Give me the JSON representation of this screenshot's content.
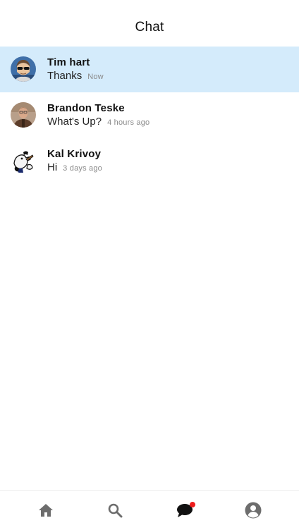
{
  "header": {
    "title": "Chat"
  },
  "chats": [
    {
      "name": "Tim hart",
      "message": "Thanks",
      "time": "Now",
      "selected": true,
      "avatar_icon": "tim-hart-avatar"
    },
    {
      "name": "Brandon Teske",
      "message": "What's Up?",
      "time": "4 hours ago",
      "selected": false,
      "avatar_icon": "brandon-teske-avatar"
    },
    {
      "name": "Kal Krivoy",
      "message": "Hi",
      "time": "3 days ago",
      "selected": false,
      "avatar_icon": "kal-krivoy-avatar"
    }
  ],
  "tabbar": {
    "tabs": [
      {
        "icon": "home-icon",
        "active": false
      },
      {
        "icon": "search-icon",
        "active": false
      },
      {
        "icon": "chat-icon",
        "active": true,
        "badge": true
      },
      {
        "icon": "account-icon",
        "active": false
      }
    ]
  },
  "colors": {
    "selected_row": "#d4ebfb",
    "badge": "#ee1c1c",
    "icon_gray": "#6d6d6d",
    "active_icon": "#111111"
  }
}
